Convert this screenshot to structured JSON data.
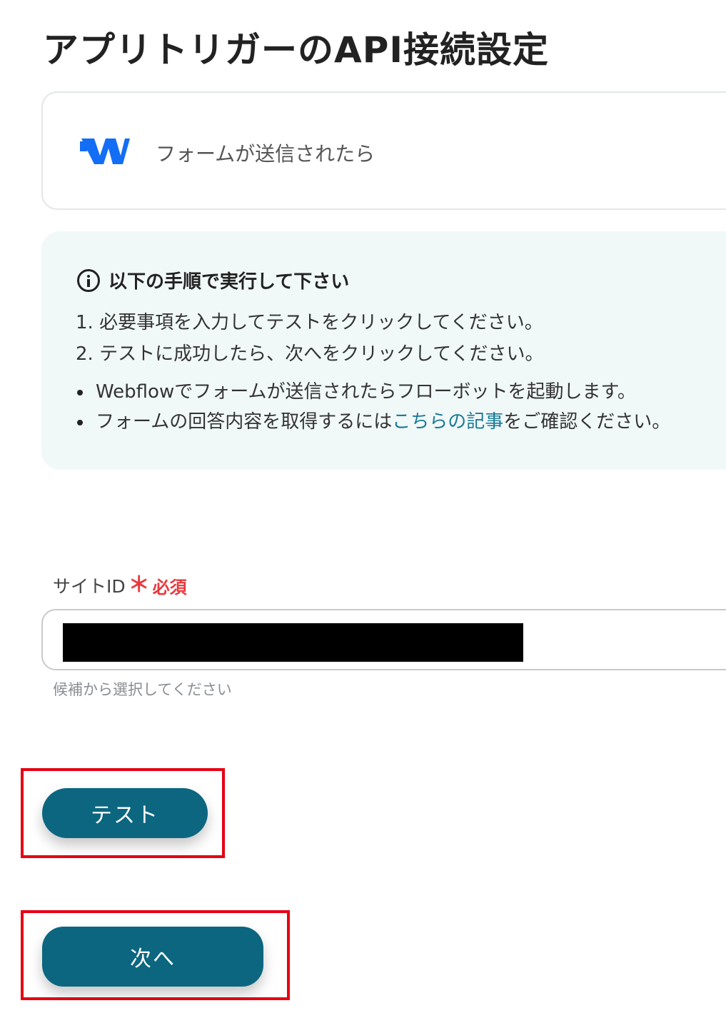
{
  "page": {
    "title": "アプリトリガーのAPI接続設定"
  },
  "trigger": {
    "app_icon": "webflow-logo-icon",
    "label": "フォームが送信されたら",
    "brand_color": "#146ef5"
  },
  "instructions": {
    "icon": "info-circle-icon",
    "title": "以下の手順で実行して下さい",
    "steps": [
      "1. 必要事項を入力してテストをクリックしてください。",
      "2. テストに成功したら、次へをクリックしてください。"
    ],
    "notes": [
      {
        "text": "Webflowでフォームが送信されたらフローボットを起動します。"
      },
      {
        "before": "フォームの回答内容を取得するには",
        "link": "こちらの記事",
        "after": "をご確認ください。"
      }
    ]
  },
  "form": {
    "site_id": {
      "label": "サイトID",
      "required_mark": "＊",
      "required_text": "必須",
      "value": "",
      "value_redacted": true,
      "help": "候補から選択してください"
    }
  },
  "buttons": {
    "test_label": "テスト",
    "next_label": "次へ"
  },
  "colors": {
    "accent": "#0c6680",
    "link": "#1a7a96",
    "required": "#e8383d",
    "highlight": "#e60012",
    "info_bg": "#f1f8f8"
  }
}
